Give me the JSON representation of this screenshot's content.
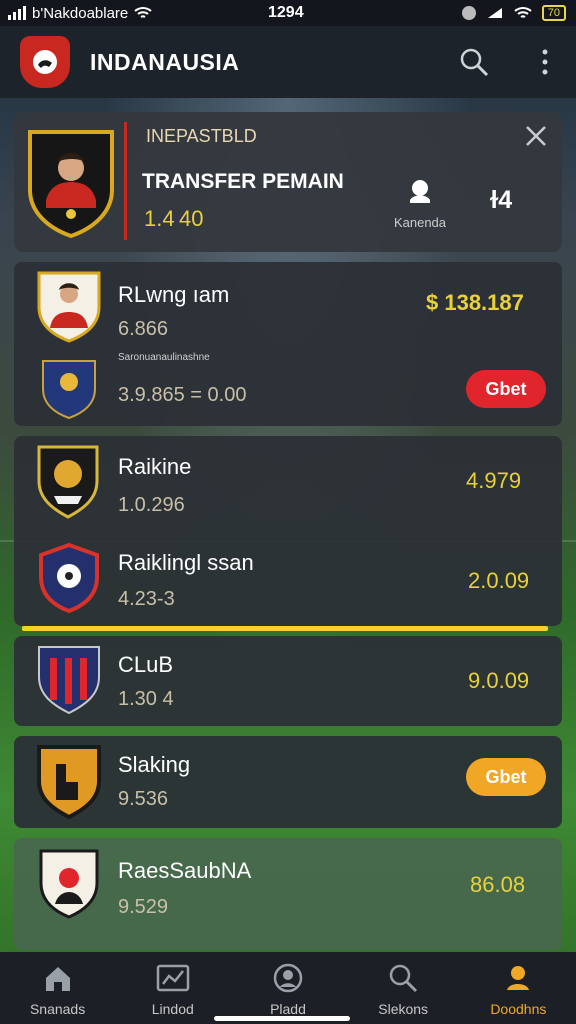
{
  "status_bar": {
    "carrier": "b'Nakdoablare",
    "time": "1294",
    "battery": "70"
  },
  "app": {
    "title": "INDANAUSIA"
  },
  "featured": {
    "label": "INEPASTBLD",
    "title": "TRANSFER PEMAIN",
    "value": "1.4 40",
    "user_label": "Kanenda",
    "count": "ɫ4"
  },
  "rows": [
    {
      "name": "RLwng ıam",
      "sub": "6.866",
      "value": "$ 138.187"
    },
    {
      "name": "",
      "note": "Saronuanaulinashne",
      "sub": "3.9.865 = 0.00",
      "button": "Gbet"
    },
    {
      "name": "Raikine",
      "sub": "1.0.296",
      "value": "4.979"
    },
    {
      "name": "Raiklingl ssan",
      "sub": "4.23-3",
      "value": "2.0.09"
    },
    {
      "name": "CLuB",
      "sub": "1.30 4",
      "value": "9.0.09"
    },
    {
      "name": "Slaking",
      "sub": "9.536",
      "button": "Gbet"
    },
    {
      "name": "RaesSaubNA",
      "sub": "9.529",
      "value": "86.08"
    }
  ],
  "nav": [
    {
      "label": "Snanads",
      "icon": "home-icon"
    },
    {
      "label": "Lindod",
      "icon": "chart-icon"
    },
    {
      "label": "Pladd",
      "icon": "profile-icon"
    },
    {
      "label": "Slekons",
      "icon": "search-icon"
    },
    {
      "label": "Doodhns",
      "icon": "user-icon"
    }
  ],
  "colors": {
    "accent": "#e8d13a",
    "brand": "#c8281f",
    "orange": "#f0a726"
  }
}
